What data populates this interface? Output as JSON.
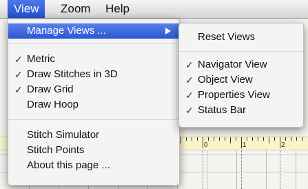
{
  "menubar": {
    "items": [
      "View",
      "Zoom",
      "Help"
    ]
  },
  "view_menu": {
    "items": [
      {
        "label": "Manage Views ...",
        "checked": false,
        "submenu": true,
        "highlighted": true
      },
      {
        "label": "Metric",
        "checked": true
      },
      {
        "label": "Draw Stitches in 3D",
        "checked": true
      },
      {
        "label": "Draw Grid",
        "checked": true
      },
      {
        "label": "Draw Hoop",
        "checked": false
      },
      {
        "label": "Stitch Simulator",
        "checked": false
      },
      {
        "label": "Stitch Points",
        "checked": false
      },
      {
        "label": "About this page ...",
        "checked": false
      }
    ]
  },
  "manage_views_submenu": {
    "items": [
      {
        "label": "Reset Views",
        "checked": false
      },
      {
        "label": "Navigator View",
        "checked": true
      },
      {
        "label": "Object View",
        "checked": true
      },
      {
        "label": "Properties View",
        "checked": true
      },
      {
        "label": "Status Bar",
        "checked": true
      }
    ]
  },
  "checkmark": "✓",
  "ruler": {
    "labels": [
      "0",
      "1",
      "2"
    ]
  },
  "colors": {
    "highlight": "#2a57d2",
    "menu_bg": "#f4f4f4"
  }
}
